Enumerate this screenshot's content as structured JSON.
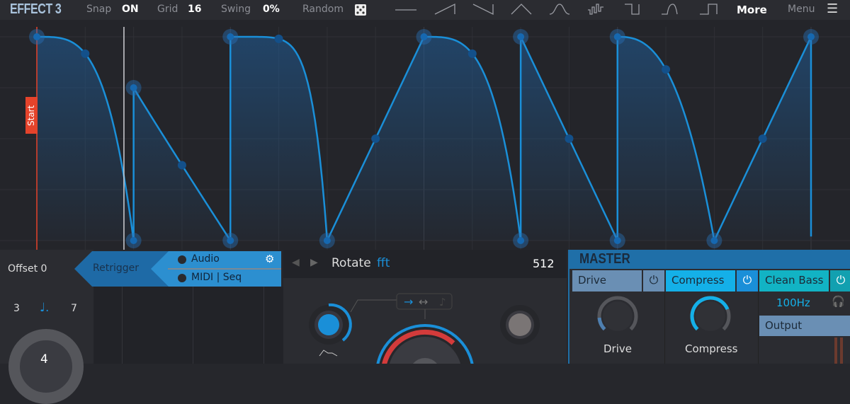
{
  "header": {
    "title": "EFFECT 3",
    "snap_label": "Snap",
    "snap_value": "ON",
    "grid_label": "Grid",
    "grid_value": "16",
    "swing_label": "Swing",
    "swing_value": "0%",
    "random_label": "Random",
    "more_label": "More",
    "menu_label": "Menu",
    "shapes": [
      "flat-shape-icon",
      "ramp-up-shape-icon",
      "ramp-down-shape-icon",
      "triangle-shape-icon",
      "bell-shape-icon",
      "random-steps-shape-icon",
      "square-down-shape-icon",
      "pulse-curve-shape-icon",
      "square-up-shape-icon"
    ]
  },
  "envelope": {
    "start_label": "Start",
    "grid": 16,
    "playhead_step": 1.8,
    "points": [
      [
        0,
        1
      ],
      [
        2,
        0
      ],
      [
        2,
        0.75
      ],
      [
        4,
        0
      ],
      [
        4,
        1
      ],
      [
        6,
        0
      ],
      [
        8,
        1
      ],
      [
        10,
        0
      ],
      [
        10,
        1
      ],
      [
        12,
        0
      ],
      [
        12,
        1
      ],
      [
        14,
        0
      ],
      [
        16,
        1
      ],
      [
        16,
        0.02
      ]
    ],
    "handles": [
      [
        1,
        0.917
      ],
      [
        3,
        0.37
      ],
      [
        5,
        0.99
      ],
      [
        7,
        0.5
      ],
      [
        9,
        0.917
      ],
      [
        11,
        0.5
      ],
      [
        13,
        0.84
      ],
      [
        15,
        0.5
      ]
    ]
  },
  "left": {
    "offset_label": "Offset 0",
    "left_num": "3",
    "right_num": "7",
    "knob_value": "4"
  },
  "retrigger": {
    "label": "Retrigger",
    "audio_label": "Audio",
    "midi_label": "MIDI | Seq"
  },
  "rotate": {
    "title": "Rotate",
    "mode": "fft",
    "value": "512"
  },
  "master": {
    "title": "MASTER",
    "drive_label": "Drive",
    "compress_label": "Compress",
    "cleanbass_label": "Clean Bass",
    "cleanbass_freq": "100Hz",
    "output_label": "Output",
    "drive_knob_label": "Drive",
    "compress_knob_label": "Compress",
    "drive_level": 0.15,
    "compress_level": 0.75
  },
  "colors": {
    "accent": "#1a8fd8",
    "start": "#e5432b",
    "compress": "#14b0e8",
    "cleanbass": "#12b3c4",
    "drive": "#6a8fb4"
  }
}
